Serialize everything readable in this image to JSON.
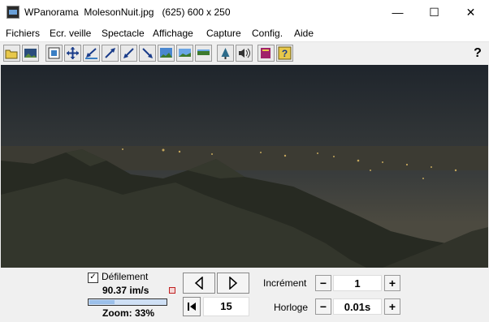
{
  "window": {
    "app_name": "WPanorama",
    "file_name": "MolesonNuit.jpg",
    "dimensions": "(625) 600 x 250",
    "minimize_glyph": "—",
    "maximize_glyph": "☐",
    "close_glyph": "✕"
  },
  "menu": {
    "items": [
      {
        "label": "Fichiers"
      },
      {
        "label": "Ecr. veille"
      },
      {
        "label": "Spectacle"
      },
      {
        "label": "Affichage"
      },
      {
        "label": "Capture"
      },
      {
        "label": "Config."
      },
      {
        "label": "Aide"
      }
    ]
  },
  "toolbar": {
    "icons": [
      "open-folder-icon",
      "image-icon",
      "fit-icon",
      "move-icon",
      "arrow-left-down-icon",
      "arrow-up-right-icon",
      "arrow-down-left-icon",
      "arrow-down-right-icon",
      "landscape-icon",
      "landscape-wide-icon",
      "flat-landscape-icon",
      "tree-icon",
      "speaker-icon",
      "book-icon",
      "help-image-icon"
    ],
    "help_label": "?"
  },
  "controls": {
    "scroll_label": "Défilement",
    "scroll_checked": "✓",
    "speed": "90.37 im/s",
    "zoom": "Zoom: 33%",
    "zoom_fraction": 0.33,
    "frame_counter": "15",
    "increment_label": "Incrément",
    "increment_value": "1",
    "clock_label": "Horloge",
    "clock_value": "0.01s",
    "minus": "−",
    "plus": "+"
  }
}
